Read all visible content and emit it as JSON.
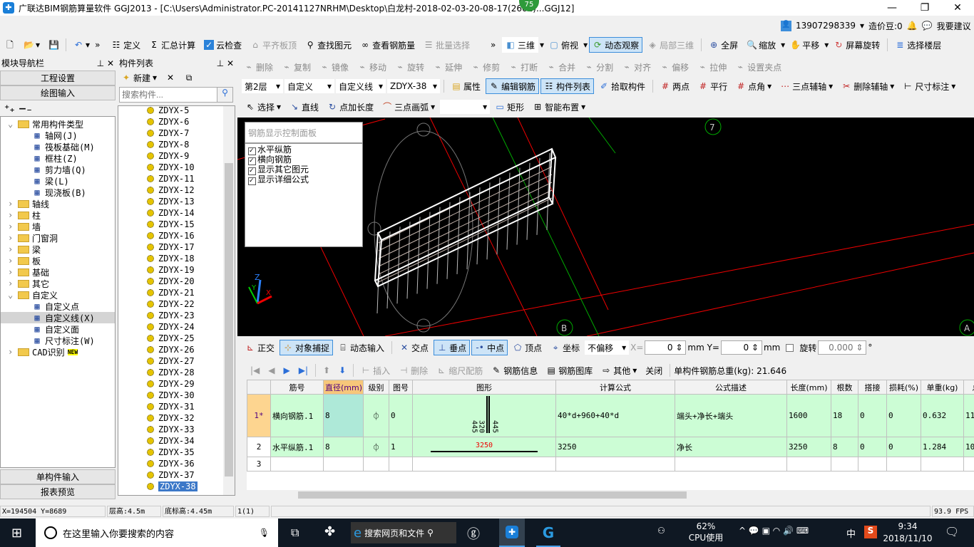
{
  "title": "广联达BIM钢筋算量软件 GGJ2013 - [C:\\Users\\Administrator.PC-20141127NRHM\\Desktop\\白龙村-2018-02-03-20-08-17(2602)...GGJ12]",
  "overlay_badge": "75",
  "user": {
    "phone": "13907298339",
    "beans": "造价豆:0",
    "suggest": "我要建议"
  },
  "toolbar1": [
    "定义",
    "汇总计算",
    "云检查",
    "平齐板顶",
    "查找图元",
    "查看钢筋量",
    "批量选择"
  ],
  "toolbar1_right": [
    "三维",
    "俯视",
    "动态观察",
    "局部三维",
    "全屏",
    "缩放",
    "平移",
    "屏幕旋转",
    "选择楼层"
  ],
  "edit_toolbar": [
    "删除",
    "复制",
    "镜像",
    "移动",
    "旋转",
    "延伸",
    "修剪",
    "打断",
    "合并",
    "分割",
    "对齐",
    "偏移",
    "拉伸",
    "设置夹点"
  ],
  "selector": {
    "floor": "第2层",
    "type": "自定义",
    "subtype": "自定义线",
    "component": "ZDYX-38"
  },
  "props_toolbar": [
    "属性",
    "编辑钢筋",
    "构件列表",
    "拾取构件",
    "两点",
    "平行",
    "点角",
    "三点辅轴",
    "删除辅轴",
    "尺寸标注"
  ],
  "draw_toolbar": [
    "选择",
    "直线",
    "点加长度",
    "三点画弧",
    "矩形",
    "智能布置"
  ],
  "nav": {
    "title": "模块导航栏",
    "project_settings": "工程设置",
    "drawing_input": "绘图输入",
    "single_input": "单构件输入",
    "report": "报表预览",
    "tree": [
      {
        "l": "常用构件类型",
        "lv": 0,
        "open": true
      },
      {
        "l": "轴网(J)",
        "lv": 1
      },
      {
        "l": "筏板基础(M)",
        "lv": 1
      },
      {
        "l": "框柱(Z)",
        "lv": 1
      },
      {
        "l": "剪力墙(Q)",
        "lv": 1
      },
      {
        "l": "梁(L)",
        "lv": 1
      },
      {
        "l": "现浇板(B)",
        "lv": 1
      },
      {
        "l": "轴线",
        "lv": 0
      },
      {
        "l": "柱",
        "lv": 0
      },
      {
        "l": "墙",
        "lv": 0
      },
      {
        "l": "门窗洞",
        "lv": 0
      },
      {
        "l": "梁",
        "lv": 0
      },
      {
        "l": "板",
        "lv": 0
      },
      {
        "l": "基础",
        "lv": 0
      },
      {
        "l": "其它",
        "lv": 0
      },
      {
        "l": "自定义",
        "lv": 0,
        "open": true
      },
      {
        "l": "自定义点",
        "lv": 1
      },
      {
        "l": "自定义线(X)",
        "lv": 1,
        "sel": true
      },
      {
        "l": "自定义面",
        "lv": 1
      },
      {
        "l": "尺寸标注(W)",
        "lv": 1
      },
      {
        "l": "CAD识别",
        "lv": 0,
        "new": "NEW"
      }
    ]
  },
  "complist": {
    "title": "构件列表",
    "new": "新建",
    "search_placeholder": "搜索构件...",
    "items": [
      "ZDYX-5",
      "ZDYX-6",
      "ZDYX-7",
      "ZDYX-8",
      "ZDYX-9",
      "ZDYX-10",
      "ZDYX-11",
      "ZDYX-12",
      "ZDYX-13",
      "ZDYX-14",
      "ZDYX-15",
      "ZDYX-16",
      "ZDYX-17",
      "ZDYX-18",
      "ZDYX-19",
      "ZDYX-20",
      "ZDYX-21",
      "ZDYX-22",
      "ZDYX-23",
      "ZDYX-24",
      "ZDYX-25",
      "ZDYX-26",
      "ZDYX-27",
      "ZDYX-28",
      "ZDYX-29",
      "ZDYX-30",
      "ZDYX-31",
      "ZDYX-32",
      "ZDYX-33",
      "ZDYX-34",
      "ZDYX-35",
      "ZDYX-36",
      "ZDYX-37",
      "ZDYX-38"
    ],
    "selected": "ZDYX-38"
  },
  "rebar_panel": {
    "title": "钢筋显示控制面板",
    "options": [
      "水平纵筋",
      "横向钢筋",
      "显示其它图元",
      "显示详细公式"
    ]
  },
  "viewport": {
    "axis_labels": [
      "7",
      "B",
      "A"
    ],
    "xyz": [
      "X",
      "Y",
      "Z"
    ]
  },
  "snap": {
    "items": [
      "正交",
      "对象捕捉",
      "动态输入",
      "交点",
      "垂点",
      "中点",
      "顶点",
      "坐标"
    ],
    "offset": "不偏移",
    "x_label": "X=",
    "x": "0",
    "y_label": "mm Y=",
    "y": "0",
    "mm": "mm",
    "rotate": "旋转",
    "rotate_val": "0.000",
    "deg": "°"
  },
  "rebar_toolbar": {
    "items": [
      "插入",
      "删除",
      "缩尺配筋",
      "钢筋信息",
      "钢筋图库",
      "其他",
      "关闭"
    ],
    "total": "单构件钢筋总重(kg): 21.646"
  },
  "table": {
    "headers": [
      "",
      "筋号",
      "直径(mm)",
      "级别",
      "图号",
      "图形",
      "计算公式",
      "公式描述",
      "长度(mm)",
      "根数",
      "搭接",
      "损耗(%)",
      "单重(kg)",
      "总"
    ],
    "rows": [
      [
        "1*",
        "横向钢筋.1",
        "8",
        "⏀",
        "0",
        "",
        "40*d+960+40*d",
        "端头+净长+端头",
        "1600",
        "18",
        "0",
        "0",
        "0.632",
        "11"
      ],
      [
        "2",
        "水平纵筋.1",
        "8",
        "⏀",
        "1",
        "",
        "3250",
        "净长",
        "3250",
        "8",
        "0",
        "0",
        "1.284",
        "10"
      ],
      [
        "3",
        "",
        "",
        "",
        "",
        "",
        "",
        "",
        "",
        "",
        "",
        "",
        "",
        ""
      ]
    ],
    "shape1_labels": [
      "445",
      "320",
      "445"
    ],
    "shape2_label": "3250"
  },
  "status": {
    "coords": "X=194504 Y=8689",
    "floor_h": "层高:4.5m",
    "base_h": "底标高:4.45m",
    "count": "1(1)",
    "fps": "93.9 FPS"
  },
  "taskbar": {
    "search": "在这里输入你要搜索的内容",
    "browser_search": "搜索网页和文件",
    "cpu": "62%",
    "cpu_label": "CPU使用",
    "ime": "中",
    "time": "9:34",
    "date": "2018/11/10"
  }
}
